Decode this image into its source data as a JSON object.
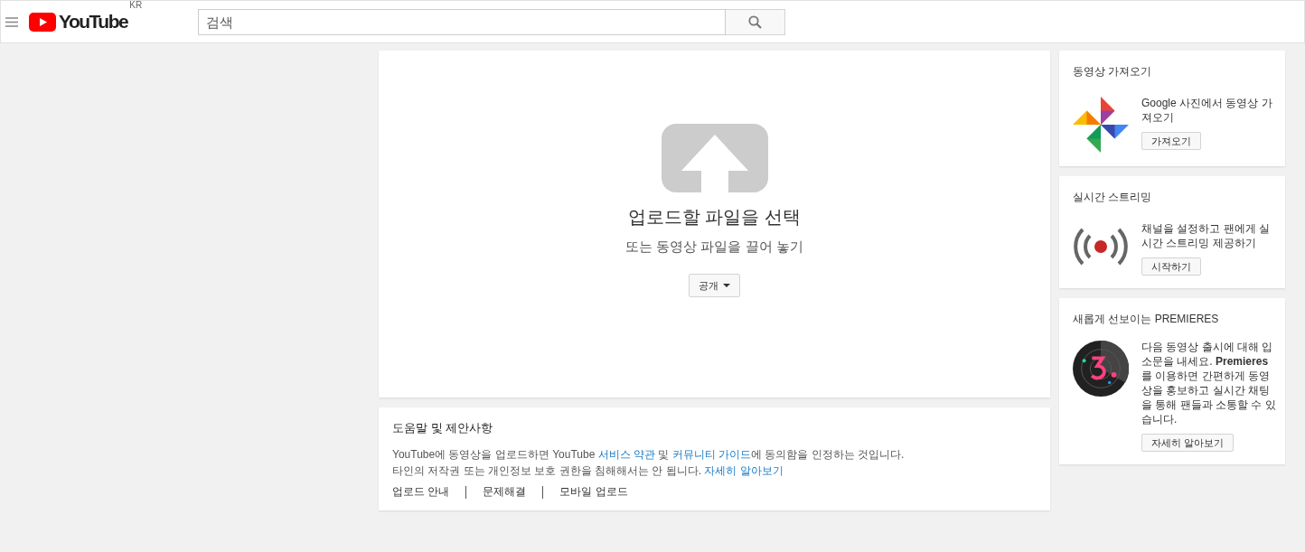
{
  "header": {
    "logo_text": "YouTube",
    "region": "KR",
    "search": {
      "placeholder": "검색"
    }
  },
  "upload": {
    "title": "업로드할 파일을 선택",
    "subtitle": "또는 동영상 파일을 끌어 놓기",
    "privacy": "공개"
  },
  "help": {
    "title": "도움말 및 제안사항",
    "lines": [
      [
        {
          "kind": "text",
          "text": "YouTube에 동영상을 업로드하면 YouTube "
        },
        {
          "kind": "link",
          "text": "서비스 약관"
        },
        {
          "kind": "text",
          "text": " 및 "
        },
        {
          "kind": "link",
          "text": "커뮤니티 가이드"
        },
        {
          "kind": "text",
          "text": "에 동의함을 인정하는 것입니다."
        }
      ],
      [
        {
          "kind": "text",
          "text": "타인의 저작권 또는 개인정보 보호 권한을 침해해서는 안 됩니다. "
        },
        {
          "kind": "link",
          "text": "자세히 알아보기"
        }
      ]
    ],
    "links": [
      "업로드 안내",
      "문제해결",
      "모바일 업로드"
    ]
  },
  "sidebar": [
    {
      "kind": "photos",
      "title": "동영상 가져오기",
      "text": "Google 사진에서 동영상 가져오기",
      "button": "가져오기"
    },
    {
      "kind": "live",
      "title": "실시간 스트리밍",
      "text": "채널을 설정하고 팬에게 실시간 스트리밍 제공하기",
      "button": "시작하기"
    },
    {
      "kind": "premieres",
      "title": "새롭게 선보이는 PREMIERES",
      "text": "다음 동영상 출시에 대해 입소문을 내세요. **Premieres**를 이용하면 간편하게 동영상을 홍보하고 실시간 채팅을 통해 팬들과 소통할 수 있습니다.",
      "button": "자세히 알아보기"
    }
  ]
}
